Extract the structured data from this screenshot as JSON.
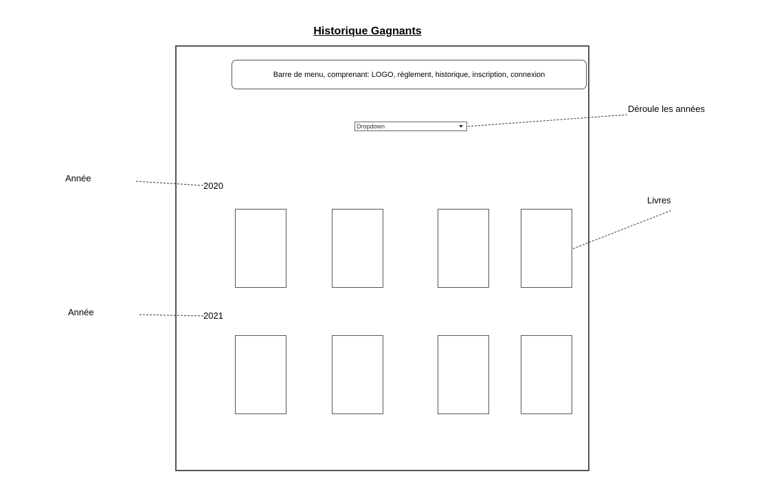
{
  "title": "Historique Gagnants",
  "menu_bar": {
    "label": "Barre de menu, comprenant: LOGO, règlement, historique, inscription, connexion"
  },
  "dropdown": {
    "value": "Dropdown"
  },
  "annotations": {
    "dropdown_note": "Déroule les années",
    "books_note": "Livres",
    "year_note_1": "Année",
    "year_note_2": "Année"
  },
  "years": [
    "2020",
    "2021"
  ]
}
